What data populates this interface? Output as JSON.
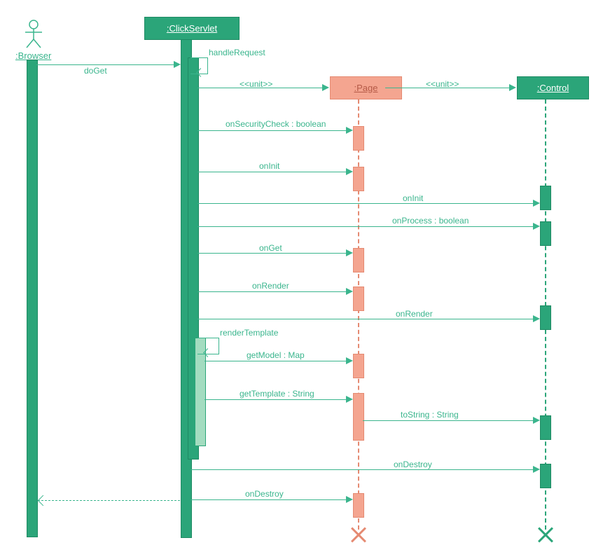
{
  "participants": {
    "browser": ":Browser",
    "clickServlet": ":ClickServlet",
    "page": ":Page",
    "control": ":Control"
  },
  "messages": {
    "doGet": "doGet",
    "handleRequest": "handleRequest",
    "unit1": "<<unit>>",
    "unit2": "<<unit>>",
    "onSecurityCheck": "onSecurityCheck : boolean",
    "onInit1": "onInit",
    "onInit2": "onInit",
    "onProcess": "onProcess : boolean",
    "onGet": "onGet",
    "onRender1": "onRender",
    "onRender2": "onRender",
    "renderTemplate": "renderTemplate",
    "getModel": "getModel : Map",
    "getTemplate": "getTemplate : String",
    "toString": "toString : String",
    "onDestroy1": "onDestroy",
    "onDestroy2": "onDestroy"
  },
  "chart_data": {
    "type": "sequence-diagram",
    "participants": [
      {
        "id": "browser",
        "label": ":Browser",
        "kind": "actor"
      },
      {
        "id": "clickServlet",
        "label": ":ClickServlet",
        "kind": "object"
      },
      {
        "id": "page",
        "label": ":Page",
        "kind": "object",
        "created": true,
        "destroyed": true
      },
      {
        "id": "control",
        "label": ":Control",
        "kind": "object",
        "created": true,
        "destroyed": true
      }
    ],
    "messages": [
      {
        "from": "browser",
        "to": "clickServlet",
        "label": "doGet",
        "kind": "sync"
      },
      {
        "from": "clickServlet",
        "to": "clickServlet",
        "label": "handleRequest",
        "kind": "self"
      },
      {
        "from": "clickServlet",
        "to": "page",
        "label": "<<unit>>",
        "kind": "create"
      },
      {
        "from": "page",
        "to": "control",
        "label": "<<unit>>",
        "kind": "create"
      },
      {
        "from": "clickServlet",
        "to": "page",
        "label": "onSecurityCheck : boolean",
        "kind": "sync"
      },
      {
        "from": "clickServlet",
        "to": "page",
        "label": "onInit",
        "kind": "sync"
      },
      {
        "from": "clickServlet",
        "to": "control",
        "label": "onInit",
        "kind": "sync"
      },
      {
        "from": "clickServlet",
        "to": "control",
        "label": "onProcess : boolean",
        "kind": "sync"
      },
      {
        "from": "clickServlet",
        "to": "page",
        "label": "onGet",
        "kind": "sync"
      },
      {
        "from": "clickServlet",
        "to": "page",
        "label": "onRender",
        "kind": "sync"
      },
      {
        "from": "clickServlet",
        "to": "control",
        "label": "onRender",
        "kind": "sync"
      },
      {
        "from": "clickServlet",
        "to": "clickServlet",
        "label": "renderTemplate",
        "kind": "self"
      },
      {
        "from": "clickServlet",
        "to": "page",
        "label": "getModel : Map",
        "kind": "sync"
      },
      {
        "from": "clickServlet",
        "to": "page",
        "label": "getTemplate : String",
        "kind": "sync"
      },
      {
        "from": "clickServlet",
        "to": "control",
        "label": "toString : String",
        "kind": "sync"
      },
      {
        "from": "clickServlet",
        "to": "control",
        "label": "onDestroy",
        "kind": "sync"
      },
      {
        "from": "clickServlet",
        "to": "page",
        "label": "onDestroy",
        "kind": "sync"
      },
      {
        "from": "clickServlet",
        "to": "browser",
        "label": "",
        "kind": "return"
      }
    ]
  }
}
